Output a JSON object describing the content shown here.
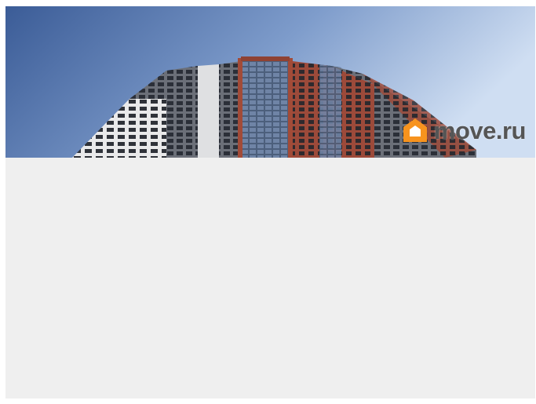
{
  "listing": {
    "photo": {
      "subject": "building-photo",
      "watermark": {
        "icon": "house-logo-icon",
        "text": "move.ru",
        "logo_color": "#f7931e",
        "text_color": "#555555"
      }
    }
  },
  "colors": {
    "sky_top": "#3b5c97",
    "sky_bottom": "#c9daf0",
    "placeholder_bg": "#efefef"
  }
}
